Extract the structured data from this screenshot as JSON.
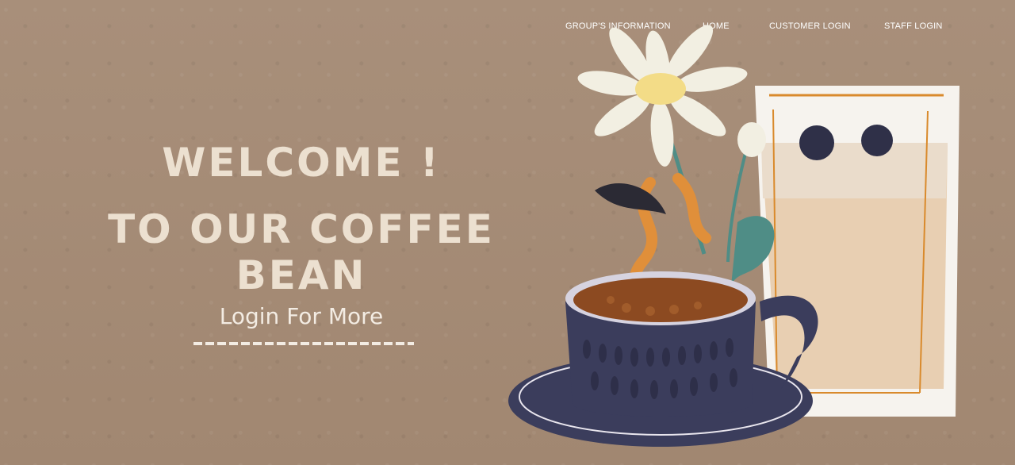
{
  "nav": {
    "items": [
      "GROUP'S INFORMATION",
      "HOME",
      "CUSTOMER LOGIN",
      "STAFF LOGIN"
    ]
  },
  "hero": {
    "line1": "WELCOME !",
    "line2": "TO OUR COFFEE BEAN",
    "cta": "Login For More"
  },
  "colors": {
    "background": "#a48b76",
    "headline": "#ece0d0",
    "cup": "#3b3d5c",
    "daisy": "#f2efe2"
  },
  "illustration": {
    "icons": [
      "daisy-icon",
      "coffee-cup-icon",
      "iced-latte-glass-icon",
      "steam-icon"
    ]
  }
}
